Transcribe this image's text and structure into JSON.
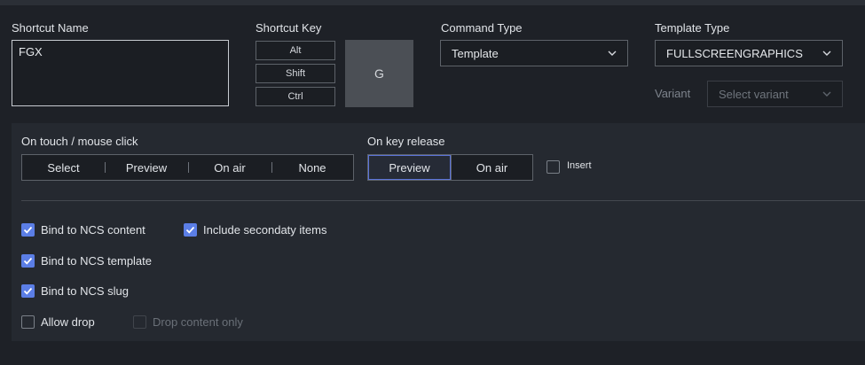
{
  "shortcut_name": {
    "label": "Shortcut Name",
    "value": "FGX"
  },
  "shortcut_key": {
    "label": "Shortcut Key",
    "modifiers": [
      "Alt",
      "Shift",
      "Ctrl"
    ],
    "key": "G"
  },
  "command_type": {
    "label": "Command Type",
    "value": "Template"
  },
  "template_type": {
    "label": "Template Type",
    "value": "FULLSCREENGRAPHICS"
  },
  "variant": {
    "label": "Variant",
    "placeholder": "Select variant"
  },
  "on_click": {
    "label": "On touch / mouse click",
    "options": [
      "Select",
      "Preview",
      "On air",
      "None"
    ]
  },
  "on_release": {
    "label": "On key release",
    "options": [
      "Preview",
      "On air"
    ],
    "selected": "Preview",
    "insert_label": "Insert",
    "insert_checked": false
  },
  "checkboxes": {
    "bind_content": {
      "label": "Bind to NCS content",
      "checked": true
    },
    "include_secondary": {
      "label": "Include secondaty items",
      "checked": true
    },
    "bind_template": {
      "label": "Bind to NCS template",
      "checked": true
    },
    "bind_slug": {
      "label": "Bind to NCS slug",
      "checked": true
    },
    "allow_drop": {
      "label": "Allow drop",
      "checked": false
    },
    "drop_content_only": {
      "label": "Drop content only",
      "checked": false,
      "disabled": true
    }
  },
  "colors": {
    "accent": "#5b7ee6",
    "background": "#1e2127",
    "panel": "#252930"
  },
  "icons": {
    "dropdown": "chevron-down-icon",
    "check": "check-icon"
  }
}
